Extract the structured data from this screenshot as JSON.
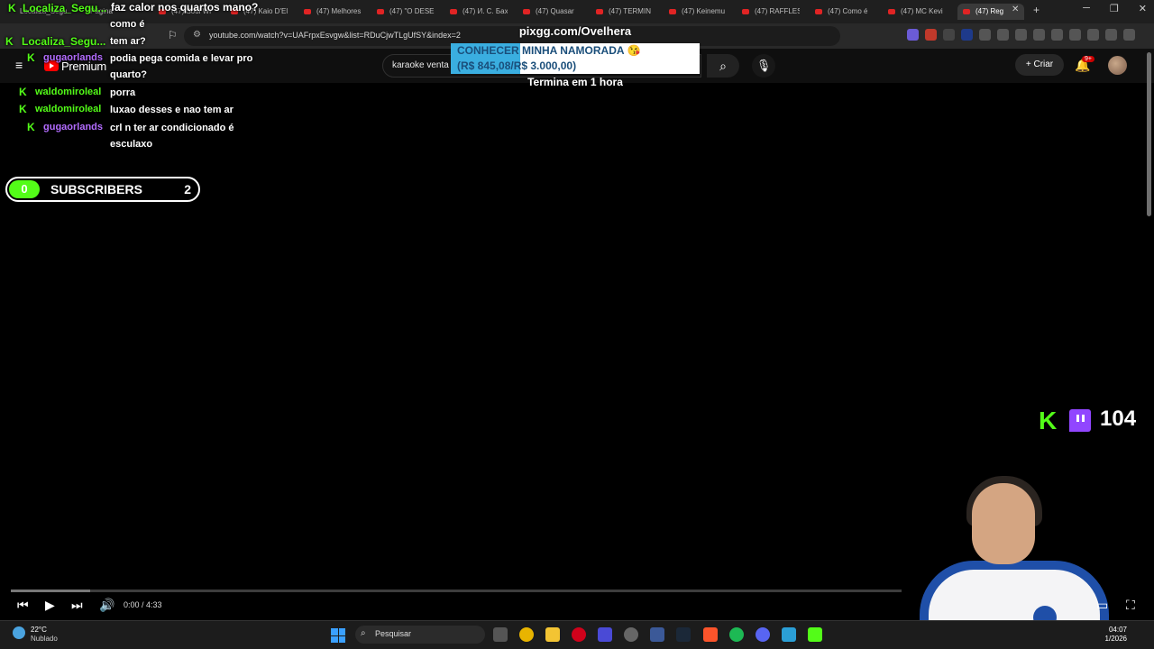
{
  "browser": {
    "tabs": [
      {
        "label": "Localiza_Segu...",
        "active": false
      },
      {
        "label": "Página",
        "active": false
      },
      {
        "label": "(47) Soul Wi",
        "active": false
      },
      {
        "label": "(47) Kaio D'El",
        "active": false
      },
      {
        "label": "(47) Melhores",
        "active": false
      },
      {
        "label": "(47) \"O DESE",
        "active": false
      },
      {
        "label": "(47) И. С. Бах",
        "active": false
      },
      {
        "label": "(47) Quasar",
        "active": false
      },
      {
        "label": "(47) TERMIN",
        "active": false
      },
      {
        "label": "(47) Keinemu",
        "active": false
      },
      {
        "label": "(47) RAFFLES",
        "active": false
      },
      {
        "label": "(47) Como é",
        "active": false
      },
      {
        "label": "(47) MC Kevi",
        "active": false
      },
      {
        "label": "(47) Reg",
        "active": true
      }
    ],
    "url": "youtube.com/watch?v=UAFrpxEsvgw&list=RDuCjwTLgUfSY&index=2"
  },
  "youtube": {
    "brand": "Premium",
    "search_value": "karaoke venta",
    "create_label": "Criar",
    "notifications_badge": "9+"
  },
  "stream_goal": {
    "url": "pixgg.com/Ovelhera",
    "title": "CONHECER MINHA NAMORADA 😘",
    "amount": "(R$ 845,08/R$ 3.000,00)",
    "progress": 0.28,
    "ends": "Termina em 1 hora"
  },
  "chat": [
    {
      "user": "Localiza_Segu...",
      "text": "faz calor nos quartos mano?",
      "color": "#53fc18"
    },
    {
      "user": "",
      "text": "como é",
      "color": "#ffffff"
    },
    {
      "user": "Localiza_Segu...",
      "text": "tem ar?",
      "color": "#53fc18"
    },
    {
      "user": "gugaorlands",
      "text": "podia pega comida e levar pro quarto?",
      "color": "#b36cff"
    },
    {
      "user": "waldomiroleal",
      "text": "porra",
      "color": "#53fc18"
    },
    {
      "user": "waldomiroleal",
      "text": "luxao desses e nao tem ar",
      "color": "#53fc18"
    },
    {
      "user": "gugaorlands",
      "text": "crl n ter ar condicionado é esculaxo",
      "color": "#b36cff"
    }
  ],
  "subs_widget": {
    "left_count": "0",
    "label": "SUBSCRIBERS",
    "right_count": "2"
  },
  "viewers": {
    "count": "104"
  },
  "player": {
    "time": "0:00 / 4:33",
    "progress": 0.0
  },
  "taskbar": {
    "temperature": "22°C",
    "weather": "Nublado",
    "search_placeholder": "Pesquisar",
    "time": "04:07",
    "date": "1/2026"
  }
}
